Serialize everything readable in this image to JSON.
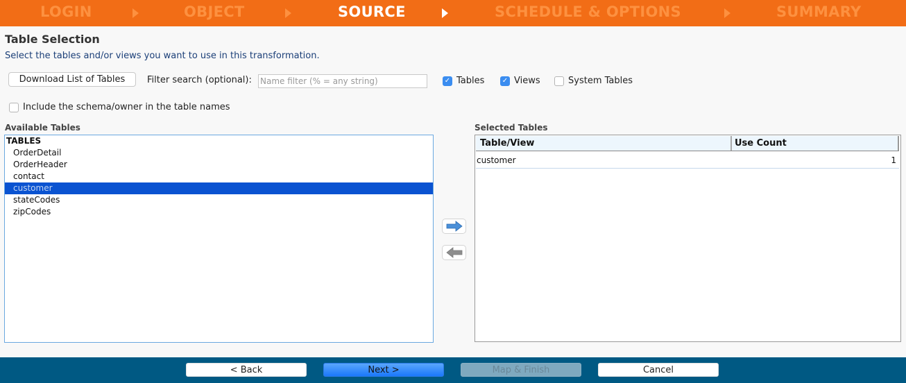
{
  "wizard": {
    "steps": [
      {
        "label": "LOGIN",
        "active": false
      },
      {
        "label": "OBJECT",
        "active": false
      },
      {
        "label": "SOURCE",
        "active": true
      },
      {
        "label": "SCHEDULE & OPTIONS",
        "active": false
      },
      {
        "label": "SUMMARY",
        "active": false
      }
    ]
  },
  "header": {
    "title": "Table Selection",
    "subtitle": "Select the tables and/or views you want to use in this transformation."
  },
  "toolbar": {
    "download_label": "Download List of Tables",
    "filter_label": "Filter search (optional):",
    "filter_value": "",
    "filter_placeholder": "Name filter (% = any string)",
    "checkboxes": [
      {
        "label": "Tables",
        "checked": true
      },
      {
        "label": "Views",
        "checked": true
      },
      {
        "label": "System Tables",
        "checked": false
      }
    ],
    "include_schema": {
      "label": "Include the schema/owner in the table names",
      "checked": false
    }
  },
  "available": {
    "label": "Available Tables",
    "group": "TABLES",
    "items": [
      "OrderDetail",
      "OrderHeader",
      "contact",
      "customer",
      "stateCodes",
      "zipCodes"
    ],
    "selected": "customer"
  },
  "selected_tables": {
    "label": "Selected Tables",
    "columns": [
      "Table/View",
      "Use Count"
    ],
    "rows": [
      {
        "name": "customer",
        "count": "1"
      }
    ]
  },
  "footer": {
    "back": "< Back",
    "next": "Next >",
    "finish": "Map & Finish",
    "cancel": "Cancel"
  },
  "colors": {
    "wizard_bg": "#f26d16",
    "footer_bg": "#005983",
    "selection": "#0a53d1",
    "accent": "#3b8df0"
  }
}
